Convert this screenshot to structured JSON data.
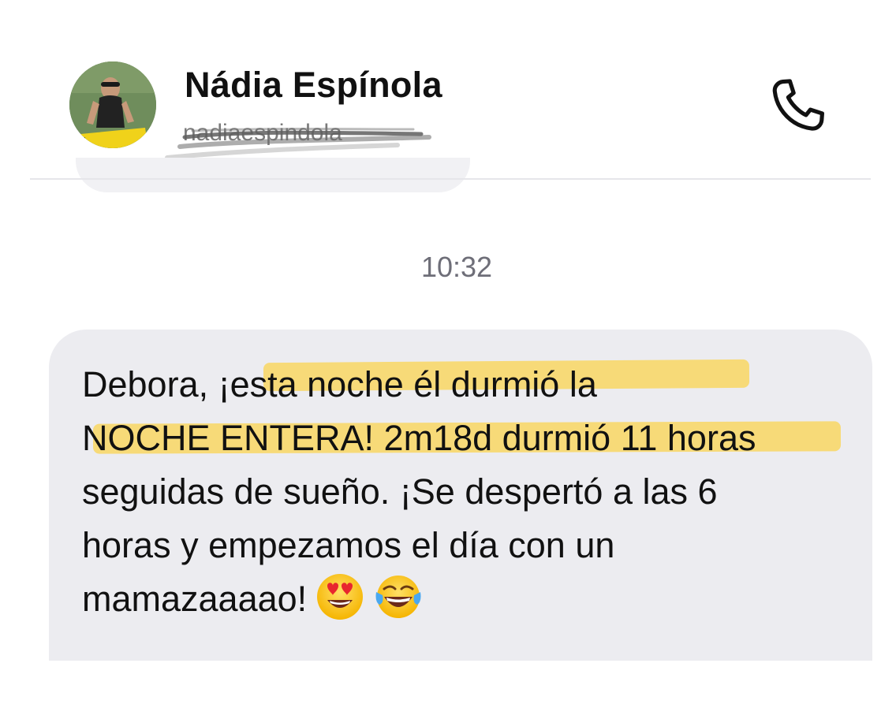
{
  "header": {
    "contact_name": "Nádia Espínola",
    "contact_handle": "nadiaespindola",
    "call_icon": "phone-icon"
  },
  "conversation": {
    "timestamp": "10:32",
    "message": {
      "lines": [
        "Debora, ¡esta noche él durmió la",
        "NOCHE ENTERA! 2m18d durmió 11 horas",
        "seguidas de sueño. ¡Se despertó a las 6",
        "horas y empezamos el día con un",
        "mamazaaaao!"
      ],
      "emojis": [
        "heart-eyes-emoji",
        "tears-of-joy-emoji"
      ],
      "highlight_color": "#f8d86a"
    }
  },
  "colors": {
    "bubble": "#ececf0",
    "text": "#111111",
    "timestamp": "#6e6e78"
  }
}
